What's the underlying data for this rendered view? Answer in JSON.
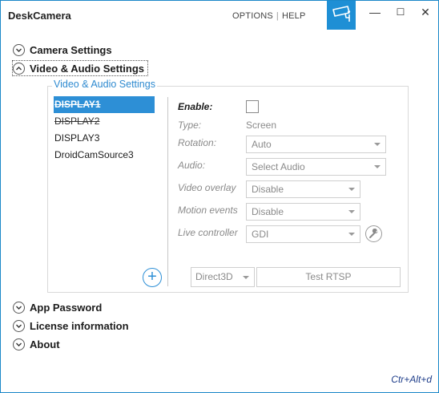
{
  "app": {
    "title": "DeskCamera"
  },
  "topmenu": {
    "options": "OPTIONS",
    "separator": "|",
    "help": "HELP"
  },
  "window_controls": {
    "minimize": "—",
    "maximize": "☐",
    "close": "✕"
  },
  "sections": {
    "camera_settings": "Camera Settings",
    "video_audio_settings": "Video & Audio Settings",
    "app_password": "App Password",
    "license_information": "License information",
    "about": "About"
  },
  "group": {
    "legend": "Video & Audio Settings",
    "sources": [
      "DISPLAY1",
      "DISPLAY2",
      "DISPLAY3",
      "DroidCamSource3"
    ],
    "selected_index": 0
  },
  "form": {
    "enable_label": "Enable:",
    "enable_checked": false,
    "type_label": "Type:",
    "type_value": "Screen",
    "rotation_label": "Rotation:",
    "rotation_value": "Auto",
    "audio_label": "Audio:",
    "audio_value": "Select Audio",
    "video_overlay_label": "Video overlay",
    "video_overlay_value": "Disable",
    "motion_events_label": "Motion events",
    "motion_events_value": "Disable",
    "live_controller_label": "Live controller",
    "live_controller_value": "GDI"
  },
  "bottom": {
    "renderer_value": "Direct3D",
    "test_rtsp_label": "Test RTSP",
    "add_symbol": "+"
  },
  "shortcut": "Ctr+Alt+d",
  "colors": {
    "accent": "#1e8fd5",
    "selection": "#2d8fd6",
    "legend": "#2e8ad0",
    "shortcut": "#1e3d8a"
  }
}
